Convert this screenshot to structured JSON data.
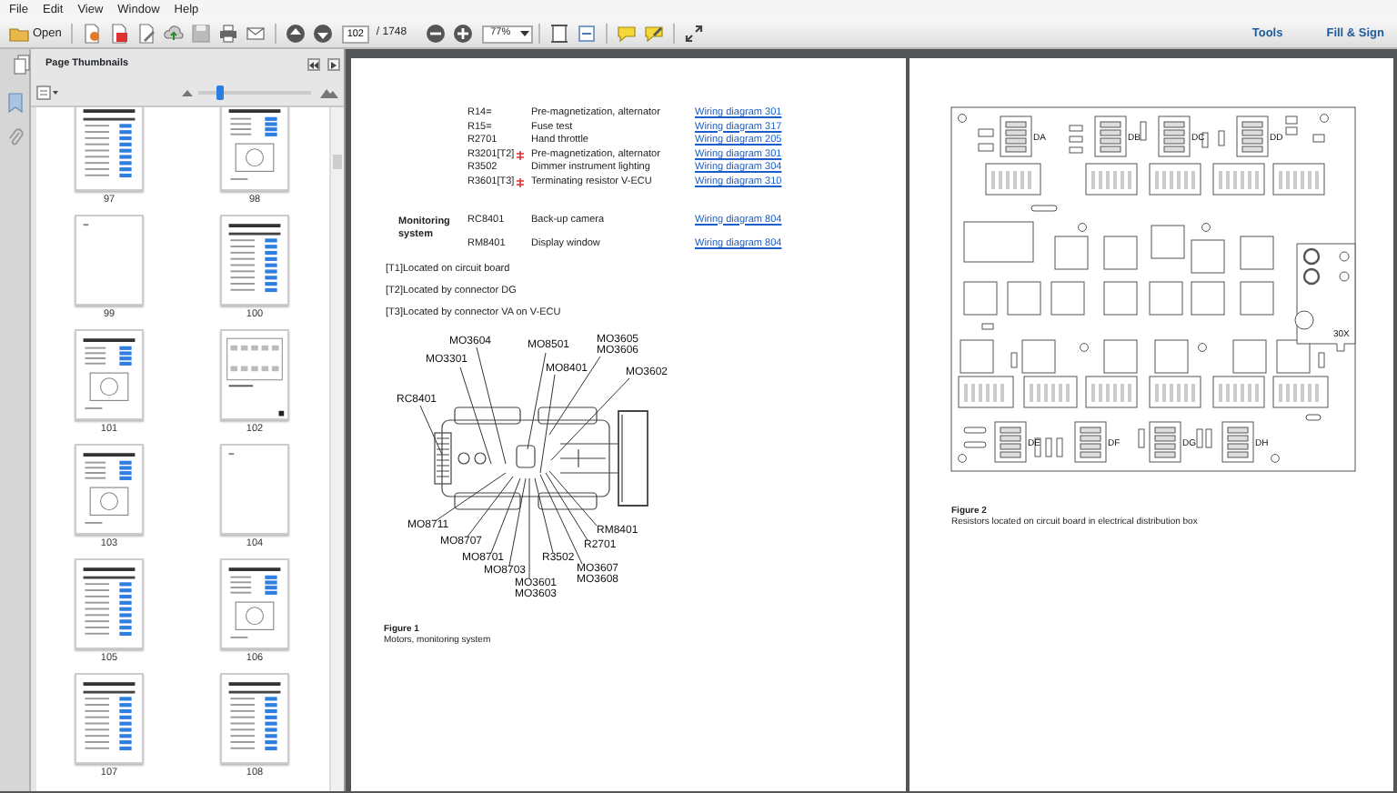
{
  "menu": [
    "File",
    "Edit",
    "View",
    "Window",
    "Help"
  ],
  "toolbar": {
    "open": "Open",
    "page": "102",
    "page_count": "/ 1748",
    "zoom": "77%",
    "tools": "Tools",
    "fill_sign": "Fill & Sign"
  },
  "sidebar": {
    "title": "Page Thumbnails",
    "thumbnail_size": {
      "level": 0.17
    },
    "thumbnails": [
      {
        "page": "97",
        "kind": "table"
      },
      {
        "page": "98",
        "kind": "diagram"
      },
      {
        "page": "99",
        "kind": "blank"
      },
      {
        "page": "100",
        "kind": "table"
      },
      {
        "page": "101",
        "kind": "diagram"
      },
      {
        "page": "102",
        "kind": "board"
      },
      {
        "page": "103",
        "kind": "diagram"
      },
      {
        "page": "104",
        "kind": "blank"
      },
      {
        "page": "105",
        "kind": "table"
      },
      {
        "page": "106",
        "kind": "diagram"
      },
      {
        "page": "107",
        "kind": "table"
      },
      {
        "page": "108",
        "kind": "table"
      }
    ]
  },
  "left_page": {
    "rows": [
      {
        "code": "R14=",
        "note": false,
        "description": "Pre-magnetization, alternator",
        "link": "Wiring diagram 301"
      },
      {
        "code": "R15=",
        "note": false,
        "description": "Fuse test",
        "link": "Wiring diagram 317"
      },
      {
        "code": "R2701",
        "note": false,
        "description": "Hand throttle",
        "link": "Wiring diagram 205"
      },
      {
        "code": "R3201[T2]",
        "note": true,
        "description": "Pre-magnetization, alternator",
        "link": "Wiring diagram 301"
      },
      {
        "code": "R3502",
        "note": false,
        "description": "Dimmer instrument lighting",
        "link": "Wiring diagram 304"
      },
      {
        "code": "R3601[T3]",
        "note": true,
        "description": "Terminating resistor V-ECU",
        "link": "Wiring diagram 310"
      }
    ],
    "monitoring": {
      "heading": "Monitoring system",
      "rows": [
        {
          "code": "RC8401",
          "description": "Back-up camera",
          "link": "Wiring diagram 804"
        },
        {
          "code": "RM8401",
          "description": "Display window",
          "link": "Wiring diagram 804"
        }
      ]
    },
    "footnotes": [
      "[T1]Located on circuit board",
      "[T2]Located by connector DG",
      "[T3]Located by connector VA on V-ECU"
    ],
    "figure": {
      "label": "Figure 1",
      "caption": "Motors, monitoring system",
      "callouts": [
        "MO3604",
        "MO3301",
        "MO8501",
        "MO3605",
        "MO3606",
        "MO8401",
        "MO3602",
        "RC8401",
        "MO8711",
        "MO8707",
        "MO8701",
        "MO8703",
        "MO3601",
        "MO3603",
        "R3502",
        "RM8401",
        "R2701",
        "MO3607",
        "MO3608"
      ]
    }
  },
  "right_page": {
    "figure": {
      "label": "Figure 2",
      "caption": "Resistors located on circuit board in electrical distribution box",
      "connector_labels": [
        "DA",
        "DB",
        "DC",
        "DD",
        "DE",
        "DF",
        "DG",
        "DH"
      ],
      "terminal_label": "30X"
    }
  }
}
